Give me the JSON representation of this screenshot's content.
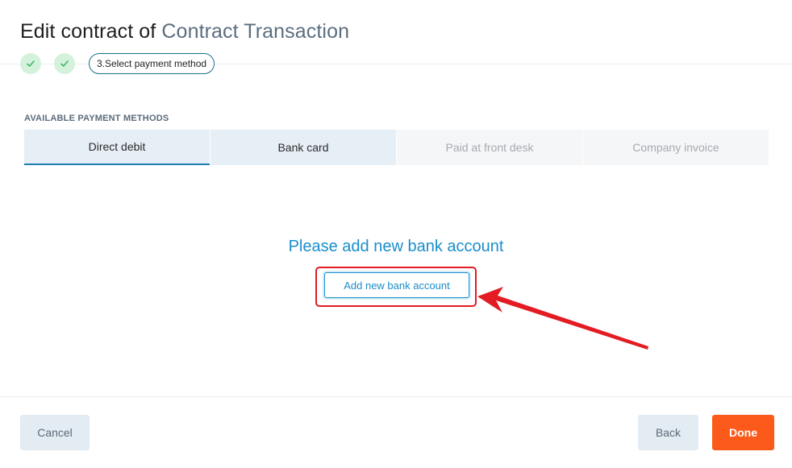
{
  "header": {
    "title_prefix": "Edit contract of",
    "title_entity": "Contract Transaction"
  },
  "stepper": {
    "completed_steps": 2,
    "current_step_label": "3.Select payment method"
  },
  "payment_methods": {
    "section_label": "AVAILABLE PAYMENT METHODS",
    "tabs": [
      {
        "label": "Direct debit",
        "state": "active"
      },
      {
        "label": "Bank card",
        "state": "enabled"
      },
      {
        "label": "Paid at front desk",
        "state": "disabled"
      },
      {
        "label": "Company invoice",
        "state": "disabled"
      }
    ]
  },
  "content": {
    "empty_title": "Please add new bank account",
    "add_button_label": "Add new bank account"
  },
  "footer": {
    "cancel_label": "Cancel",
    "back_label": "Back",
    "done_label": "Done"
  },
  "colors": {
    "accent": "#1a8ecb",
    "primary_button": "#fc5a1b",
    "annotation_red": "#e31b23",
    "step_done_bg": "#d4f1dc"
  }
}
